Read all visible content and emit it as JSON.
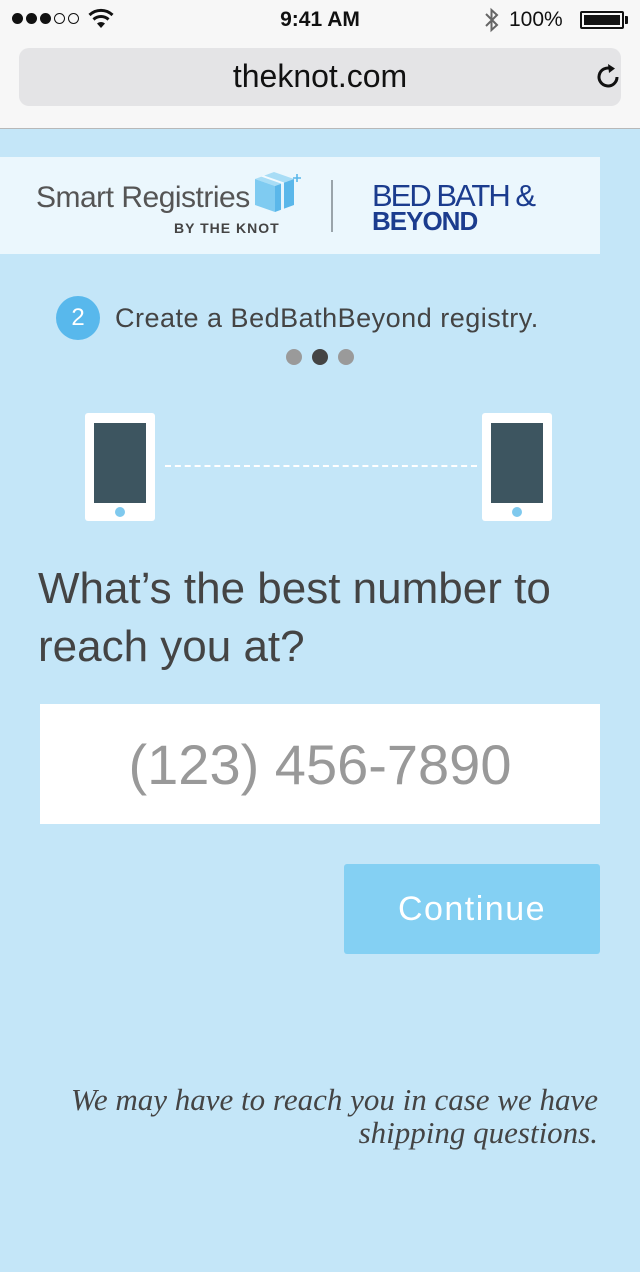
{
  "status_bar": {
    "time": "9:41 AM",
    "battery_percent": "100%",
    "signal_bars_filled": 3,
    "signal_bars_total": 5
  },
  "browser": {
    "url": "theknot.com",
    "reload_icon": "reload-icon"
  },
  "banner": {
    "brand_title": "Smart Registries",
    "brand_subtitle": "BY THE KNOT",
    "partner_line1": "BED BATH &",
    "partner_line2": "BEYOND",
    "gift_icon": "gift-box-icon"
  },
  "step": {
    "number": "2",
    "text": "Create a BedBathBeyond registry.",
    "pager_total": 3,
    "pager_active": 2
  },
  "form": {
    "question": "What’s the best number to reach you at?",
    "phone_placeholder": "(123) 456-7890",
    "continue_label": "Continue",
    "note": "We may have to reach you in case we have shipping questions."
  },
  "colors": {
    "background": "#c4e6f8",
    "banner": "#ebf7fd",
    "accent": "#58b8ec",
    "button": "#84d0f3",
    "partner_blue": "#1b3c8e"
  }
}
